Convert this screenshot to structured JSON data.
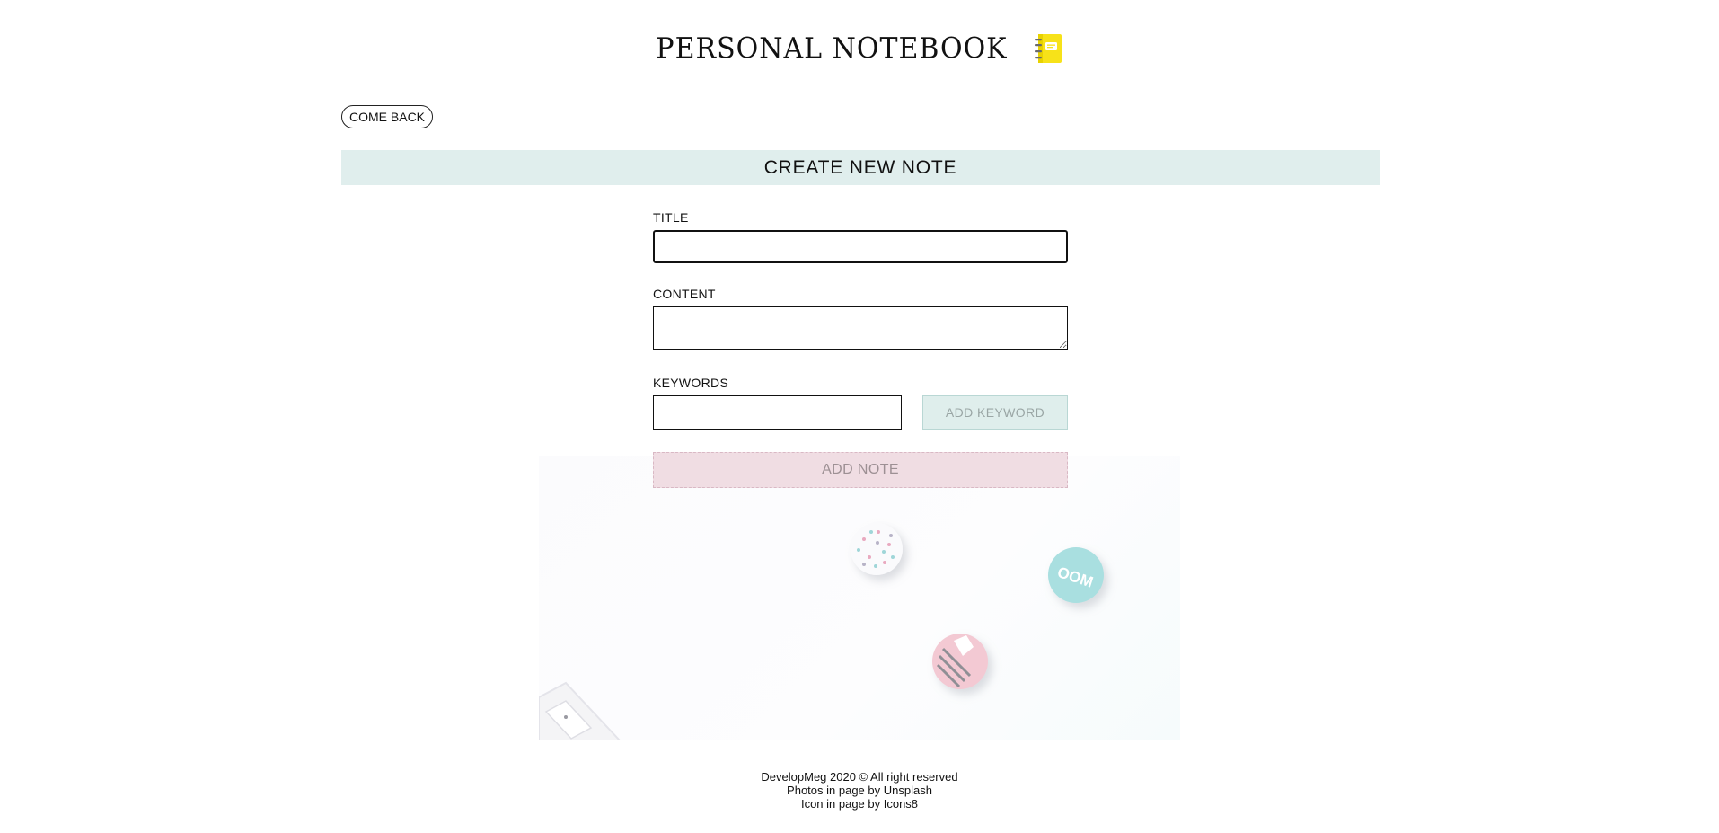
{
  "header": {
    "title": "PERSONAL NOTEBOOK",
    "logo_icon": "notebook-icon",
    "logo_color": "#f7e219"
  },
  "nav": {
    "back_label": "COME BACK"
  },
  "main": {
    "section_title": "CREATE NEW NOTE",
    "banner_color": "#e0eeed",
    "form": {
      "title_label": "TITLE",
      "title_value": "",
      "content_label": "CONTENT",
      "content_value": "",
      "keywords_label": "KEYWORDS",
      "keywords_value": "",
      "add_keyword_label": "ADD KEYWORD",
      "add_note_label": "ADD NOTE"
    }
  },
  "footer": {
    "line1": "DevelopMeg 2020 © All right reserved",
    "line2": "Photos in page by Unsplash",
    "line3": "Icon in page by Icons8"
  }
}
